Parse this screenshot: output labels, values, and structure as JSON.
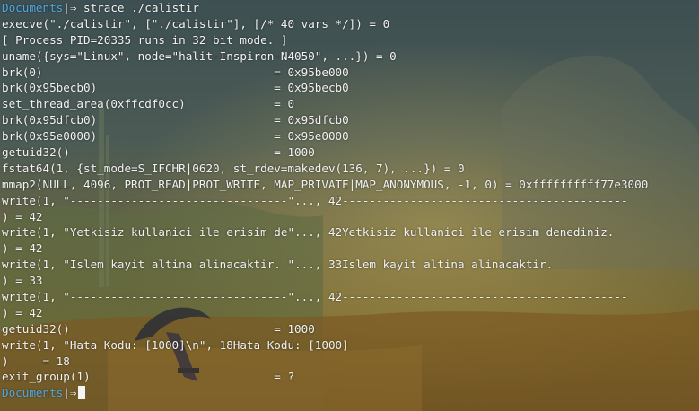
{
  "terminal": {
    "prompt": {
      "dir": "Documents",
      "separator": "|⇒"
    },
    "command": "strace ./calistir",
    "output_lines": [
      "execve(\"./calistir\", [\"./calistir\"], [/* 40 vars */]) = 0",
      "[ Process PID=20335 runs in 32 bit mode. ]",
      "uname({sys=\"Linux\", node=\"halit-Inspiron-N4050\", ...}) = 0",
      "brk(0)                                  = 0x95be000",
      "brk(0x95becb0)                          = 0x95becb0",
      "set_thread_area(0xffcdf0cc)             = 0",
      "brk(0x95dfcb0)                          = 0x95dfcb0",
      "brk(0x95e0000)                          = 0x95e0000",
      "getuid32()                              = 1000",
      "fstat64(1, {st_mode=S_IFCHR|0620, st_rdev=makedev(136, 7), ...}) = 0",
      "mmap2(NULL, 4096, PROT_READ|PROT_WRITE, MAP_PRIVATE|MAP_ANONYMOUS, -1, 0) = 0xffffffffff77e3000",
      "write(1, \"--------------------------------\"..., 42------------------------------------------",
      ") = 42",
      "write(1, \"Yetkisiz kullanici ile erisim de\"..., 42Yetkisiz kullanici ile erisim denediniz.",
      ") = 42",
      "write(1, \"Islem kayit altina alinacaktir. \"..., 33Islem kayit altina alinacaktir.",
      ") = 33",
      "write(1, \"--------------------------------\"..., 42------------------------------------------",
      ") = 42",
      "getuid32()                              = 1000",
      "write(1, \"Hata Kodu: [1000]\\n\", 18Hata Kodu: [1000]",
      ")     = 18",
      "exit_group(1)                           = ?"
    ]
  },
  "colors": {
    "prompt_dir": "#4fa8e0",
    "text": "#f2f2f2"
  }
}
